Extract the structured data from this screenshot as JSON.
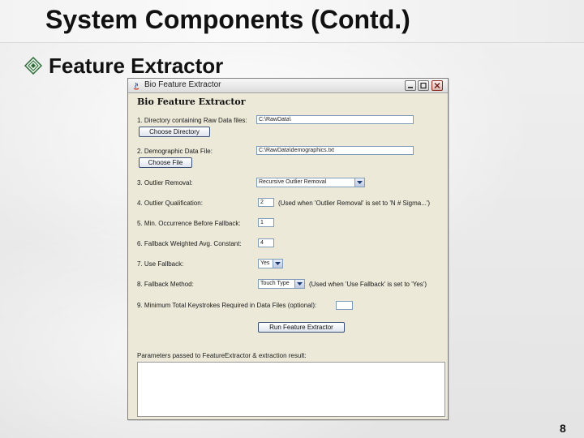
{
  "slide": {
    "title": "System Components (Contd.)",
    "bullet": "Feature Extractor",
    "page_number": "8"
  },
  "window": {
    "title": "Bio Feature Extractor",
    "header": "Bio Feature Extractor"
  },
  "form": {
    "raw_dir": {
      "label": "1. Directory containing Raw Data files:",
      "value": "C:\\RawData\\",
      "button": "Choose Directory"
    },
    "demo_file": {
      "label": "2. Demographic Data File:",
      "value": "C:\\RawData\\demographics.txt",
      "button": "Choose File"
    },
    "outlier_removal": {
      "label": "3. Outlier Removal:",
      "value": "Recursive Outlier Removal"
    },
    "outlier_qualification": {
      "label": "4. Outlier Qualification:",
      "value": "2",
      "note": "(Used when 'Outlier Removal' is set to 'N # Sigma...')"
    },
    "min_occurrence": {
      "label": "5. Min. Occurrence Before Fallback:",
      "value": "1"
    },
    "fallback_constant": {
      "label": "6. Fallback Weighted Avg. Constant:",
      "value": "4"
    },
    "use_fallback": {
      "label": "7. Use Fallback:",
      "value": "Yes"
    },
    "fallback_method": {
      "label": "8. Fallback Method:",
      "value": "Touch Type",
      "note": "(Used when 'Use Fallback' is set to 'Yes')"
    },
    "min_keystrokes": {
      "label": "9. Minimum Total Keystrokes Required in Data Files (optional):",
      "value": ""
    },
    "run_button": "Run Feature Extractor",
    "output_label": "Parameters passed to FeatureExtractor & extraction result:",
    "output_text": ""
  }
}
